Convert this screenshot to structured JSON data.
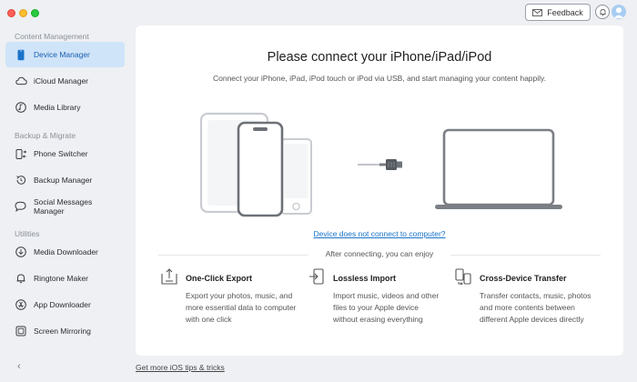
{
  "header": {
    "feedback_label": "Feedback"
  },
  "sidebar": {
    "sections": [
      {
        "label": "Content Management",
        "items": [
          {
            "label": "Device Manager",
            "icon": "device-icon",
            "active": true
          },
          {
            "label": "iCloud Manager",
            "icon": "cloud-icon"
          },
          {
            "label": "Media Library",
            "icon": "music-note-icon"
          }
        ]
      },
      {
        "label": "Backup & Migrate",
        "items": [
          {
            "label": "Phone Switcher",
            "icon": "phone-switch-icon"
          },
          {
            "label": "Backup Manager",
            "icon": "backup-icon"
          },
          {
            "label": "Social Messages Manager",
            "icon": "chat-icon"
          }
        ]
      },
      {
        "label": "Utilities",
        "items": [
          {
            "label": "Media Downloader",
            "icon": "download-icon"
          },
          {
            "label": "Ringtone Maker",
            "icon": "bell-icon"
          },
          {
            "label": "App Downloader",
            "icon": "app-store-icon"
          },
          {
            "label": "Screen Mirroring",
            "icon": "screen-icon"
          }
        ]
      }
    ]
  },
  "main": {
    "title": "Please connect your iPhone/iPad/iPod",
    "subtitle": "Connect your iPhone, iPad, iPod touch or iPod via USB, and start managing your content happily.",
    "help_link": "Device does not connect to computer?",
    "after_connecting": "After connecting, you can enjoy",
    "features": [
      {
        "title": "One-Click Export",
        "icon": "export-icon",
        "lines": [
          "Export your photos, music, and",
          "more essential data to computer",
          "with one click"
        ]
      },
      {
        "title": "Lossless Import",
        "icon": "import-icon",
        "lines": [
          "Import music, videos and other",
          "files to your Apple device",
          "without erasing everything"
        ]
      },
      {
        "title": "Cross-Device Transfer",
        "icon": "transfer-icon",
        "lines": [
          "Transfer contacts, music, photos",
          "and more contents between",
          "different Apple devices directly"
        ]
      }
    ]
  },
  "footer": {
    "tips_link": "Get more iOS tips & tricks"
  },
  "colors": {
    "accent": "#1a73c9",
    "active_bg": "#cfe4f8",
    "background": "#eef0f3"
  }
}
